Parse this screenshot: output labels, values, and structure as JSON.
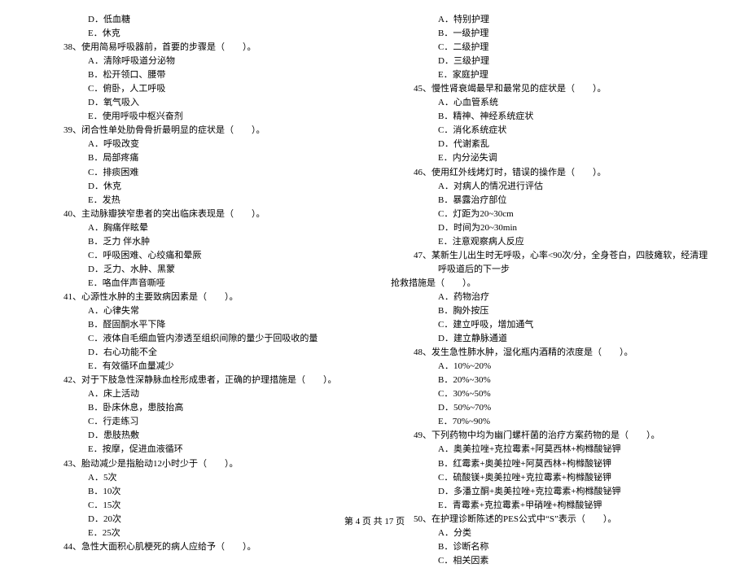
{
  "left": {
    "pre_opts": [
      "D．低血糖",
      "E．休克"
    ],
    "q38": "38、使用简易呼吸器前，首要的步骤是（　　）。",
    "q38_opts": [
      "A．清除呼吸道分泌物",
      "B．松开领口、腰带",
      "C．俯卧，人工呼吸",
      "D．氧气吸入",
      "E．使用呼吸中枢兴奋剂"
    ],
    "q39": "39、闭合性单处肋骨骨折最明显的症状是（　　）。",
    "q39_opts": [
      "A．呼吸改变",
      "B．局部疼痛",
      "C．排痰困难",
      "D．休克",
      "E．发热"
    ],
    "q40": "40、主动脉瓣狭窄患者的突出临床表现是（　　）。",
    "q40_opts": [
      "A．胸痛伴眩晕",
      "B．乏力 伴水肿",
      "C．呼吸困难、心绞痛和晕厥",
      "D．乏力、水肿、黑蒙",
      "E．咯血伴声音嘶哑"
    ],
    "q41": "41、心源性水肿的主要致病因素是（　　）。",
    "q41_opts": [
      "A．心律失常",
      "B．醛固酮水平下降",
      "C．液体自毛细血管内渗透至组织间隙的量少于回吸收的量",
      "D．右心功能不全",
      "E．有效循环血量减少"
    ],
    "q42": "42、对于下肢急性深静脉血栓形成患者，正确的护理措施是（　　）。",
    "q42_opts": [
      "A．床上活动",
      "B．卧床休息，患肢抬高",
      "C．行走练习",
      "D．患肢热敷",
      "E．按摩，促进血液循环"
    ],
    "q43": "43、胎动减少是指胎动12小时少于（　　）。",
    "q43_opts": [
      "A．5次",
      "B．10次",
      "C．15次",
      "D．20次",
      "E．25次"
    ],
    "q44": "44、急性大面积心肌梗死的病人应给予（　　）。"
  },
  "right": {
    "pre_opts": [
      "A．特别护理",
      "B．一级护理",
      "C．二级护理",
      "D．三级护理",
      "E．家庭护理"
    ],
    "q45": "45、慢性肾衰竭最早和最常见的症状是（　　）。",
    "q45_opts": [
      "A．心血管系统",
      "B．精神、神经系统症状",
      "C．消化系统症状",
      "D．代谢紊乱",
      "E．内分泌失调"
    ],
    "q46": "46、使用红外线烤灯时，错误的操作是（　　）。",
    "q46_opts": [
      "A．对病人的情况进行评估",
      "B．暴露治疗部位",
      "C．灯距为20~30cm",
      "D．时间为20~30min",
      "E．注意观察病人反应"
    ],
    "q47": "47、某新生儿出生时无呼吸，心率<90次/分，全身苍白，四肢瘫软，经清理呼吸道后的下一步",
    "q47_cont": "抢救措施是（　　）。",
    "q47_opts": [
      "A．药物治疗",
      "B．胸外按压",
      "C．建立呼吸，增加通气",
      "D．建立静脉通道"
    ],
    "q48": "48、发生急性肺水肿，湿化瓶内酒精的浓度是（　　）。",
    "q48_opts": [
      "A．10%~20%",
      "B．20%~30%",
      "C．30%~50%",
      "D．50%~70%",
      "E．70%~90%"
    ],
    "q49": "49、下列药物中均为幽门螺杆菌的治疗方案药物的是（　　）。",
    "q49_opts": [
      "A．奥美拉唑+克拉霉素+阿莫西林+枸橼酸铋钾",
      "B．红霉素+奥美拉唑+阿莫西林+枸橼酸铋钾",
      "C．硫酸镁+奥美拉唑+克拉霉素+枸橼酸铋钾",
      "D．多潘立酮+奥美拉唑+克拉霉素+枸橼酸铋钾",
      "E．青霉素+克拉霉素+甲硝唑+枸橼酸铋钾"
    ],
    "q50": "50、在护理诊断陈述的PES公式中“S”表示（　　）。",
    "q50_opts": [
      "A．分类",
      "B．诊断名称",
      "C．相关因素"
    ]
  },
  "footer": "第 4 页 共 17 页"
}
